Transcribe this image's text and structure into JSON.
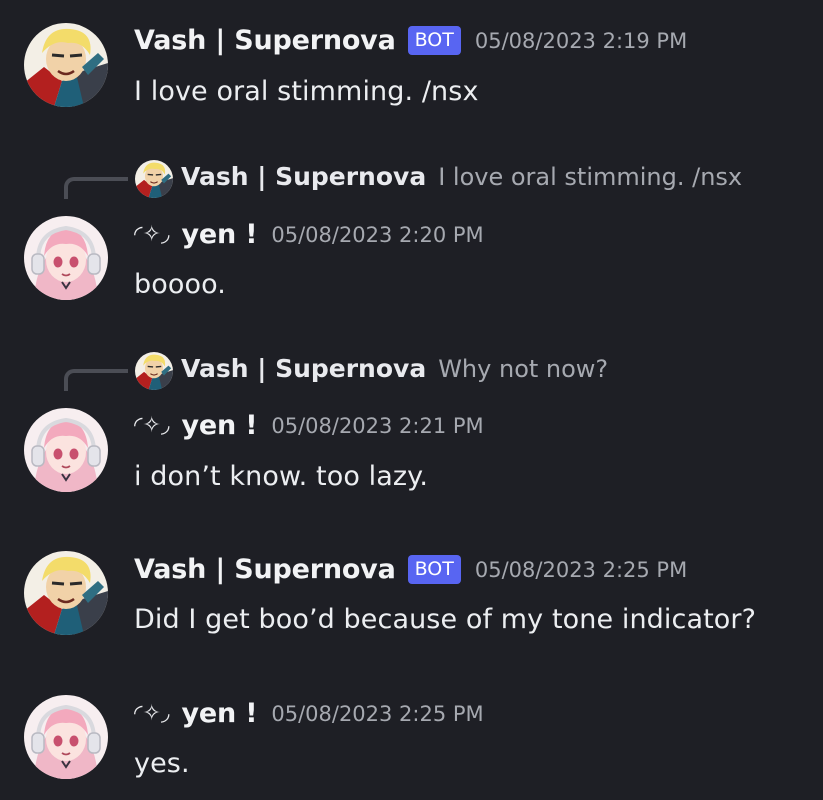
{
  "messages": [
    {
      "author": "Vash | Supernova",
      "bot_tag": "BOT",
      "timestamp": "05/08/2023 2:19 PM",
      "text": "I love oral stimming. /nsx"
    },
    {
      "reply_to": {
        "author": "Vash | Supernova",
        "text": "I love oral stimming. /nsx"
      },
      "author_deco": "◜✧◞",
      "author": "yen !",
      "timestamp": "05/08/2023 2:20 PM",
      "text": "boooo."
    },
    {
      "reply_to": {
        "author": "Vash | Supernova",
        "text": "Why not now?"
      },
      "author_deco": "◜✧◞",
      "author": "yen !",
      "timestamp": "05/08/2023 2:21 PM",
      "text": "i don’t know. too lazy."
    },
    {
      "author": "Vash | Supernova",
      "bot_tag": "BOT",
      "timestamp": "05/08/2023 2:25 PM",
      "text": "Did I get boo’d because of my tone indicator?"
    },
    {
      "author_deco": "◜✧◞",
      "author": "yen !",
      "timestamp": "05/08/2023 2:25 PM",
      "text": "yes."
    }
  ],
  "colors": {
    "background": "#1e1f25",
    "bot_tag": "#5865f2",
    "timestamp": "#a6a9b0",
    "text": "#eceef1"
  },
  "icons": {
    "vash_avatar": "bot-avatar-blonde-character",
    "yen_avatar": "user-avatar-pink-hair-headphones"
  }
}
